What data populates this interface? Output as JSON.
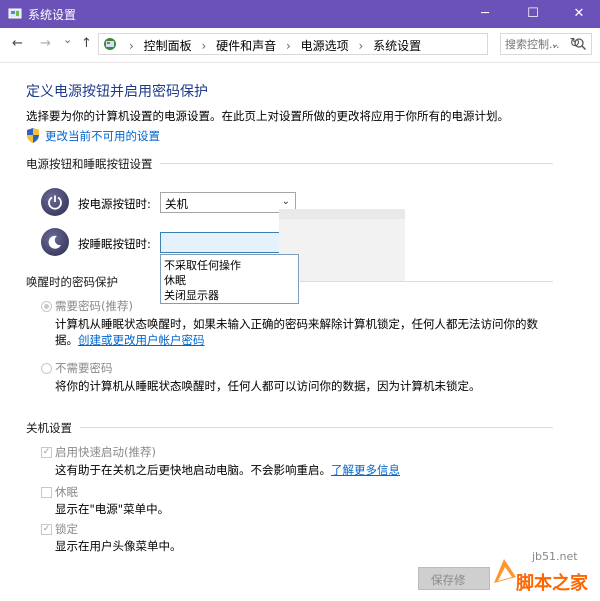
{
  "window": {
    "title": "系统设置",
    "controls": {
      "minimize": "─",
      "maximize": "☐",
      "close": "✕"
    }
  },
  "address": {
    "back": "←",
    "forward": "→",
    "recent": "⌄",
    "up": "↑",
    "crumbs": [
      "控制面板",
      "硬件和声音",
      "电源选项",
      "系统设置"
    ],
    "dropdown": "⌄",
    "refresh": "↻",
    "search_placeholder": "搜索控制..."
  },
  "page": {
    "title": "定义电源按钮并启用密码保护",
    "description": "选择要为你的计算机设置的电源设置。在此页上对设置所做的更改将应用于你所有的电源计划。",
    "change_settings_link": "更改当前不可用的设置"
  },
  "power_buttons": {
    "group_title": "电源按钮和睡眠按钮设置",
    "power_label": "按电源按钮时:",
    "power_value": "关机",
    "sleep_label": "按睡眠按钮时:",
    "sleep_value": "",
    "sleep_options": [
      "不采取任何操作",
      "休眠",
      "关闭显示器"
    ]
  },
  "password": {
    "group_title": "唤醒时的密码保护",
    "require_label": "需要密码(推荐)",
    "require_desc": "计算机从睡眠状态唤醒时，如果未输入正确的密码来解除计算机锁定，任何人都无法访问你的数",
    "require_desc2": "据。",
    "require_link": "创建或更改用户帐户密码",
    "norequire_label": "不需要密码",
    "norequire_desc": "将你的计算机从睡眠状态唤醒时，任何人都可以访问你的数据，因为计算机未锁定。"
  },
  "shutdown": {
    "group_title": "关机设置",
    "fast_startup_label": "启用快速启动(推荐)",
    "fast_startup_desc": "这有助于在关机之后更快地启动电脑。不会影响重启。",
    "fast_startup_link": "了解更多信息",
    "hibernate_label": "休眠",
    "hibernate_desc": "显示在\"电源\"菜单中。",
    "lock_label": "锁定",
    "lock_desc": "显示在用户头像菜单中。",
    "checkmark": "✓"
  },
  "footer": {
    "save_label": "保存修"
  },
  "watermark": {
    "url": "jb51.net",
    "name": "脚本之家"
  }
}
